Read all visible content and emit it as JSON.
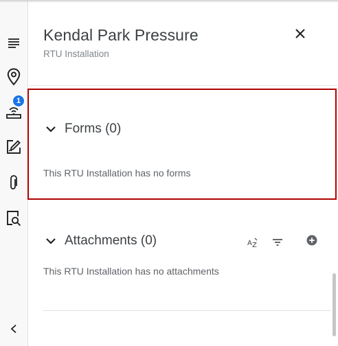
{
  "header": {
    "title": "Kendal Park Pressure",
    "subtitle": "RTU Installation"
  },
  "rail": {
    "icons": [
      "menu-lines-icon",
      "location-pin-icon",
      "rtu-device-icon",
      "edit-form-icon",
      "paperclip-icon",
      "search-document-icon",
      "chevron-left-icon"
    ],
    "badge_count": "1",
    "badge_color": "#1a73e8"
  },
  "forms": {
    "title": "Forms (0)",
    "empty_message": "This RTU Installation has no forms"
  },
  "attachments": {
    "title": "Attachments (0)",
    "empty_message": "This RTU Installation has no attachments",
    "tools": [
      "sort-az-icon",
      "filter-icon",
      "add-circle-icon"
    ]
  },
  "colors": {
    "highlight_border": "#b00000",
    "accent": "#1a73e8"
  }
}
